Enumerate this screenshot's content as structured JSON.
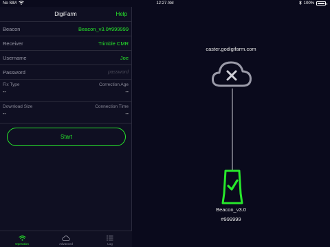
{
  "status_bar": {
    "carrier": "No SIM",
    "time": "12:27 AM",
    "battery_percent": "100%"
  },
  "left_panel": {
    "title": "DigiFarm",
    "help_label": "Help",
    "fields": [
      {
        "label": "Beacon",
        "value": "Beacon_v3.0#999999"
      },
      {
        "label": "Receiver",
        "value": "Trimble CMR"
      },
      {
        "label": "Username",
        "value": "Joe"
      },
      {
        "label": "Password",
        "value": "",
        "placeholder": "password"
      }
    ],
    "stats": [
      {
        "left_label": "Fix Type",
        "left_value": "--",
        "right_label": "Correction Age",
        "right_value": "--"
      },
      {
        "left_label": "Download Size",
        "left_value": "--",
        "right_label": "Connection Time",
        "right_value": "--"
      }
    ],
    "start_label": "Start"
  },
  "tab_bar": {
    "tabs": [
      {
        "label": "Operation",
        "icon": "wifi-icon",
        "active": true
      },
      {
        "label": "Advanced",
        "icon": "cloud-icon",
        "active": false
      },
      {
        "label": "Log",
        "icon": "list-icon",
        "active": false
      }
    ]
  },
  "diagram": {
    "caster_host": "caster.godigifarm.com",
    "caster_status_icon": "cloud-x-icon",
    "beacon_status_icon": "beacon-check-icon",
    "beacon_name": "Beacon_v3.0",
    "beacon_id": "#999999"
  },
  "colors": {
    "accent": "#27e82b",
    "background": "#0a0a1c",
    "muted": "#9a9aa8"
  }
}
